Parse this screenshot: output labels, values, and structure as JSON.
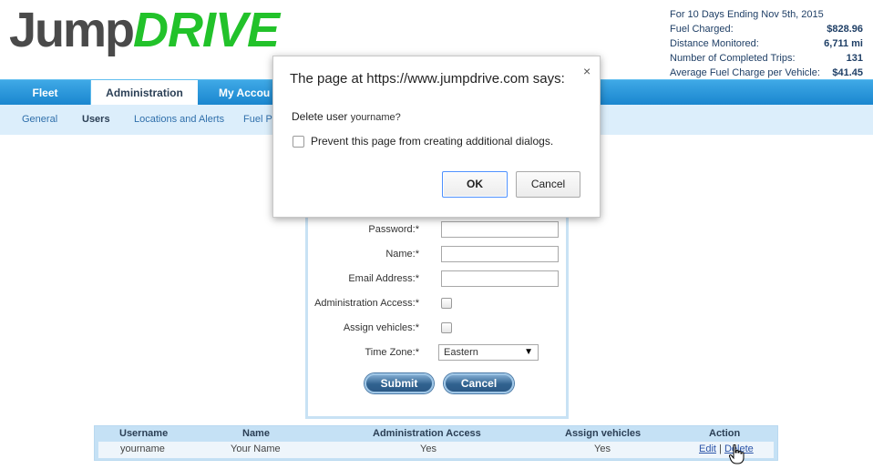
{
  "logo": {
    "part1": "Jump",
    "part2": "DRIVE"
  },
  "stats": {
    "heading": "For 10 Days Ending Nov 5th, 2015",
    "rows": [
      {
        "label": "Fuel Charged:",
        "value": "$828.96"
      },
      {
        "label": "Distance Monitored:",
        "value": "6,711 mi"
      },
      {
        "label": "Number of Completed Trips:",
        "value": "131"
      },
      {
        "label": "Average Fuel Charge per Vehicle:",
        "value": "$41.45"
      }
    ]
  },
  "nav": {
    "tabs": [
      "Fleet",
      "Administration",
      "My Accou"
    ]
  },
  "subnav": {
    "items": [
      "General",
      "Users",
      "Locations and Alerts",
      "Fuel P"
    ]
  },
  "form": {
    "password_label": "Password:*",
    "name_label": "Name:*",
    "email_label": "Email Address:*",
    "admin_label": "Administration Access:*",
    "assign_label": "Assign vehicles:*",
    "timezone_label": "Time Zone:*",
    "timezone_value": "Eastern",
    "submit": "Submit",
    "cancel": "Cancel"
  },
  "table": {
    "headers": [
      "Username",
      "Name",
      "Administration Access",
      "Assign vehicles",
      "Action"
    ],
    "rows": [
      {
        "username": "yourname",
        "name": "Your Name",
        "admin": "Yes",
        "assign": "Yes",
        "edit": "Edit",
        "sep": "|",
        "delete": "Delete"
      }
    ]
  },
  "dialog": {
    "title": "The page at https://www.jumpdrive.com says:",
    "close": "×",
    "message": "Delete user",
    "username": "yourname?",
    "prevent": "Prevent this page from creating additional dialogs.",
    "ok": "OK",
    "cancel": "Cancel"
  },
  "colors": {
    "brand_green": "#22c22a",
    "nav_blue": "#1a86cf",
    "subnav_bg": "#dceefb",
    "button_blue": "#30628f"
  }
}
